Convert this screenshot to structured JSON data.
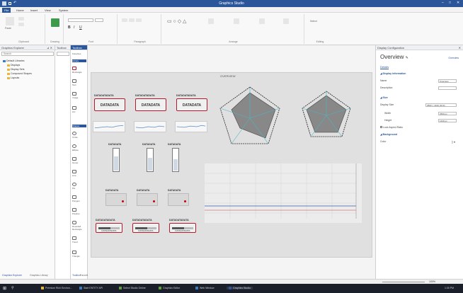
{
  "window": {
    "title": "Graphics Studio",
    "controls": [
      "–",
      "□",
      "✕"
    ]
  },
  "ribbon_tabs": [
    "File",
    "Home",
    "Insert",
    "View",
    "System"
  ],
  "ribbon_groups": [
    "Clipboard",
    "Drawing",
    "Font",
    "Paragraph",
    "Arrange",
    "Editing"
  ],
  "ribbon_buttons": {
    "paste": "Paste",
    "select": "Select"
  },
  "left_panel": {
    "header": "Graphics Explorer",
    "search_placeholder": "Search",
    "tree": [
      "Default Libraries",
      "Displays",
      "Display Sets",
      "Compound Shapes",
      "Layouts"
    ],
    "bottom_tabs": [
      "Graphics Explorer",
      "Graphics Library"
    ]
  },
  "toolbox": {
    "header": "Toolbox",
    "section_top": "Favorites",
    "section_library": "Library",
    "section_shapes": "Shapes",
    "items": [
      "Rectangle",
      "Text",
      "Image",
      "Arc",
      "Circle",
      "Ellipse",
      "Group",
      "Line",
      "Pie",
      "Polygon",
      "Polyline",
      "Rounded Rectangle",
      "Trend",
      "Triangle"
    ],
    "bottom_tabs": [
      "Toolbox",
      "Favorites"
    ]
  },
  "canvas": {
    "title": "OVERVIEW",
    "dd_header": "DATADATADATA",
    "dd_value": "DATADATA",
    "gauge_header": "DATADATA",
    "slider_header": "DATADATADATA",
    "slider_caption": "DATADATADATA",
    "gauge_fills": [
      0.62,
      0.55,
      0.5
    ]
  },
  "properties": {
    "header": "Display Configuration",
    "title": "Overview",
    "edit_link": "Overview",
    "tab": "Details",
    "section_info": "Display Information",
    "name_label": "Name",
    "name_value": "Overview",
    "desc_label": "Description",
    "section_size": "Size",
    "display_size_label": "Display Size",
    "display_size_value": "2560 × 1440 (16:9)",
    "width_label": "Width",
    "width_value": "2560 px",
    "height_label": "Height",
    "height_value": "1440 px",
    "lock_label": "Lock Aspect Ratio",
    "section_bg": "Background",
    "color_label": "Color"
  },
  "statusbar": {
    "zoom": "100%"
  },
  "taskbar": {
    "items": [
      "Premium Rich Environ...",
      "Start ENTITY API",
      "Select Studio Online",
      "Graphics Editor",
      "Web Window",
      "Graphics Studio"
    ],
    "time": "1:30 PM"
  }
}
